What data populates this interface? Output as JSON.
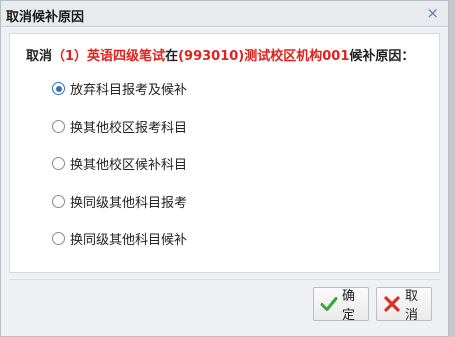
{
  "dialog": {
    "title": "取消候补原因",
    "close_glyph": "×"
  },
  "prompt": {
    "prefix": "取消",
    "course": "（1）英语四级笔试",
    "middle": "在",
    "center": "(993010)测试校区机构001",
    "suffix": "候补原因："
  },
  "options": [
    {
      "label": "放弃科目报考及候补",
      "checked": true
    },
    {
      "label": "换其他校区报考科目",
      "checked": false
    },
    {
      "label": "换其他校区候补科目",
      "checked": false
    },
    {
      "label": "换同级其他科目报考",
      "checked": false
    },
    {
      "label": "换同级其他科目候补",
      "checked": false
    }
  ],
  "buttons": {
    "confirm_label": "确定",
    "cancel_label": "取消"
  },
  "colors": {
    "highlight": "#e0211d",
    "radio_checked": "#2f6fbe",
    "confirm_icon": "#3aa63a",
    "cancel_icon": "#d93025"
  },
  "icons": {
    "confirm": "check-icon",
    "cancel": "x-icon",
    "close": "close-icon"
  }
}
